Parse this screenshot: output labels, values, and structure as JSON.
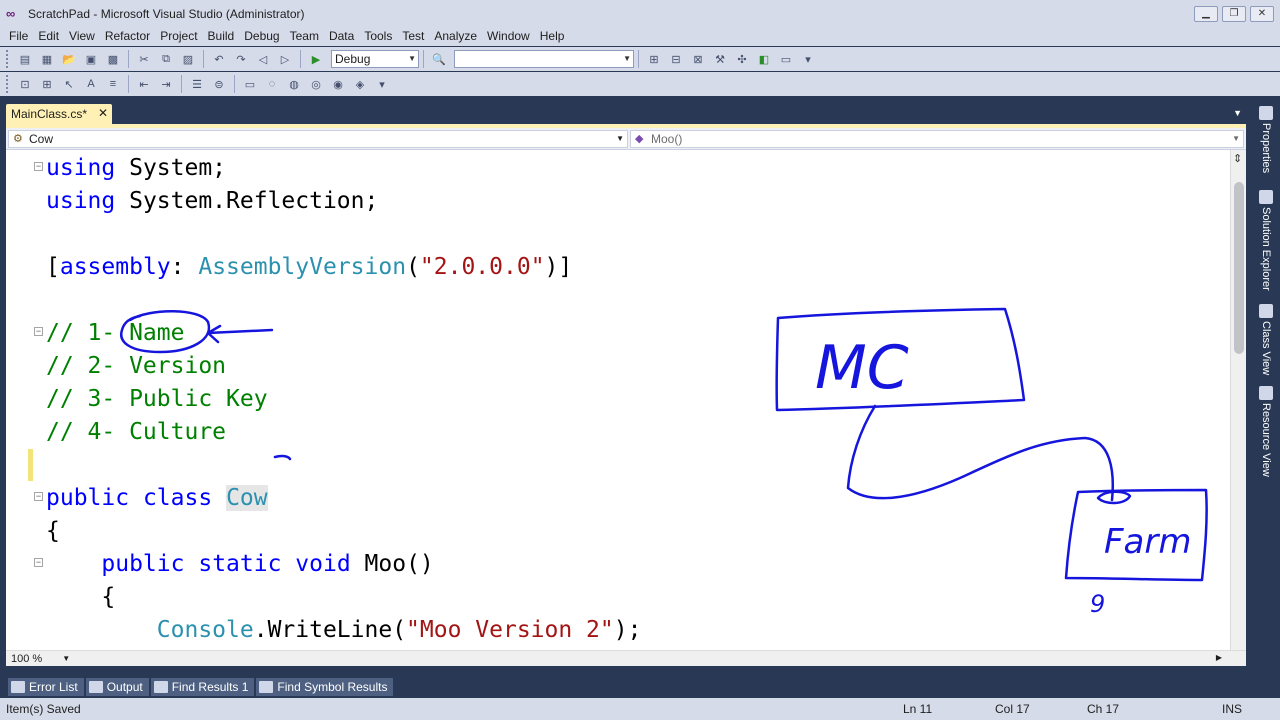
{
  "window": {
    "title": "ScratchPad - Microsoft Visual Studio (Administrator)",
    "buttons": [
      "minimize",
      "restore",
      "close"
    ]
  },
  "menu": [
    "File",
    "Edit",
    "View",
    "Refactor",
    "Project",
    "Build",
    "Debug",
    "Team",
    "Data",
    "Tools",
    "Test",
    "Analyze",
    "Window",
    "Help"
  ],
  "toolbar": {
    "solution_config": "Debug",
    "find_box": "",
    "icons_row1": [
      "new-project-icon",
      "add-item-icon",
      "open-icon",
      "save-icon",
      "save-all-icon",
      "cut-icon",
      "copy-icon",
      "paste-icon",
      "undo-icon",
      "redo-icon",
      "navigate-backward-icon",
      "navigate-forward-icon",
      "start-debugging-icon",
      "find-in-files-icon",
      "solution-explorer-icon",
      "properties-icon",
      "object-browser-icon",
      "toolbox-icon",
      "start-page-icon",
      "extension-icon",
      "command-window-icon"
    ],
    "icons_row2": [
      "quick-info-icon",
      "parameter-info-icon",
      "complete-word-icon",
      "decrease-indent-icon",
      "increase-indent-icon",
      "comment-icon",
      "uncomment-icon",
      "bookmark-icon",
      "prev-bookmark-icon",
      "next-bookmark-icon",
      "clear-bookmarks-icon"
    ]
  },
  "document": {
    "tab_label": "MainClass.cs*",
    "nav_class": "Cow",
    "nav_member": "Moo()",
    "zoom": "100 %",
    "code_lines": [
      [
        {
          "t": "using",
          "c": "kw"
        },
        {
          "t": " System;",
          "c": "pl"
        }
      ],
      [
        {
          "t": "using",
          "c": "kw"
        },
        {
          "t": " System.Reflection;",
          "c": "pl"
        }
      ],
      [],
      [
        {
          "t": "[",
          "c": "pl"
        },
        {
          "t": "assembly",
          "c": "kw"
        },
        {
          "t": ": ",
          "c": "pl"
        },
        {
          "t": "AssemblyVersion",
          "c": "tp"
        },
        {
          "t": "(",
          "c": "pl"
        },
        {
          "t": "\"2.0.0.0\"",
          "c": "str"
        },
        {
          "t": ")]",
          "c": "pl"
        }
      ],
      [],
      [
        {
          "t": "// 1- Name",
          "c": "cm"
        }
      ],
      [
        {
          "t": "// 2- Version",
          "c": "cm"
        }
      ],
      [
        {
          "t": "// 3- Public Key",
          "c": "cm"
        }
      ],
      [
        {
          "t": "// 4- Culture",
          "c": "cm"
        }
      ],
      [],
      [
        {
          "t": "public",
          "c": "kw"
        },
        {
          "t": " ",
          "c": "pl"
        },
        {
          "t": "class",
          "c": "kw"
        },
        {
          "t": " ",
          "c": "pl"
        },
        {
          "t": "Cow",
          "c": "tp hl"
        }
      ],
      [
        {
          "t": "{",
          "c": "pl"
        }
      ],
      [
        {
          "t": "    ",
          "c": "pl"
        },
        {
          "t": "public",
          "c": "kw"
        },
        {
          "t": " ",
          "c": "pl"
        },
        {
          "t": "static",
          "c": "kw"
        },
        {
          "t": " ",
          "c": "pl"
        },
        {
          "t": "void",
          "c": "kw"
        },
        {
          "t": " Moo()",
          "c": "pl"
        }
      ],
      [
        {
          "t": "    {",
          "c": "pl"
        }
      ],
      [
        {
          "t": "        ",
          "c": "pl"
        },
        {
          "t": "Console",
          "c": "tp"
        },
        {
          "t": ".WriteLine(",
          "c": "pl"
        },
        {
          "t": "\"Moo Version 2\"",
          "c": "str"
        },
        {
          "t": ");",
          "c": "pl"
        }
      ]
    ]
  },
  "ink": {
    "box1_label": "MC",
    "box2_label": "Farm",
    "note": "9",
    "color": "#1515dd"
  },
  "side_tabs": [
    "Properties",
    "Solution Explorer",
    "Class View",
    "Resource View"
  ],
  "bottom_tabs": [
    "Error List",
    "Output",
    "Find Results 1",
    "Find Symbol Results"
  ],
  "status": {
    "message": "Item(s) Saved",
    "line": "Ln 11",
    "col": "Col 17",
    "ch": "Ch 17",
    "mode": "INS"
  },
  "colors": {
    "keyword": "#0000ff",
    "type": "#2b91af",
    "string": "#a31515",
    "comment": "#008000",
    "tab_active": "#fff1b5",
    "chrome": "#293955"
  }
}
